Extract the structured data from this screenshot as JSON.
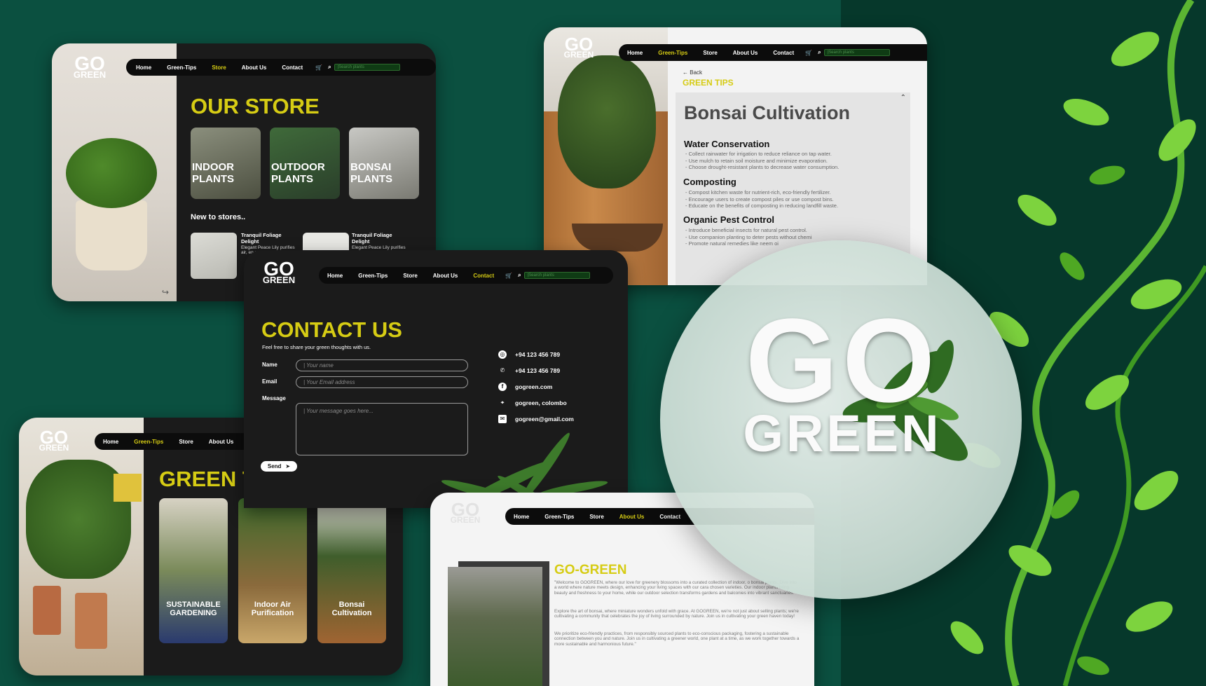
{
  "brand": {
    "logo_top": "GO",
    "logo_bottom": "GREEN"
  },
  "nav_items": [
    "Home",
    "Green-Tips",
    "Store",
    "About Us",
    "Contact"
  ],
  "search_placeholder": "|Search plants",
  "store": {
    "title": "OUR STORE",
    "categories": [
      "INDOOR\nPLANTS",
      "OUTDOOR\nPLANTS",
      "BONSAI\nPLANTS"
    ],
    "new_heading": "New to stores..",
    "products": [
      {
        "name": "Tranquil Foliage Delight",
        "desc": "Elegant Peace Lily purifies air, en spa gr"
      },
      {
        "name": "Tranquil Foliage Delight",
        "desc": "Elegant Peace Lily purifies"
      }
    ]
  },
  "tips_detail": {
    "back": "Back",
    "section": "GREEN TIPS",
    "title": "Bonsai Cultivation",
    "sections": [
      {
        "heading": "Water Conservation",
        "bullets": [
          "- Collect rainwater for irrigation to reduce reliance on tap water.",
          "- Use mulch to retain soil moisture and minimize evaporation.",
          "- Choose drought-resistant plants to decrease water consumption."
        ]
      },
      {
        "heading": "Composting",
        "bullets": [
          "- Compost kitchen waste for nutrient-rich, eco-friendly fertilizer.",
          "- Encourage users to create compost piles or use compost bins.",
          "- Educate on the benefits of composting in reducing landfill waste."
        ]
      },
      {
        "heading": "Organic Pest Control",
        "bullets": [
          "- Introduce beneficial insects for natural pest control.",
          "- Use companion planting to deter pests without chemi",
          "- Promote natural remedies like neem oi"
        ]
      }
    ]
  },
  "contact": {
    "title": "CONTACT US",
    "subtitle": "Feel free to share your green thoughts with us.",
    "name_label": "Name",
    "name_placeholder": "| Your name",
    "email_label": "Email",
    "email_placeholder": "| Your Email address",
    "message_label": "Message",
    "message_placeholder": "| Your message goes here...",
    "send_label": "Send",
    "info": [
      {
        "icon": "whatsapp-icon",
        "text": "+94 123 456 789"
      },
      {
        "icon": "phone-icon",
        "text": "+94 123 456 789"
      },
      {
        "icon": "facebook-icon",
        "text": "gogreen.com"
      },
      {
        "icon": "location-icon",
        "text": "gogreen, colombo"
      },
      {
        "icon": "mail-icon",
        "text": "gogreen@gmail.com"
      }
    ]
  },
  "tips_list": {
    "title": "GREEN T",
    "cards": [
      "SUSTAINABLE\nGARDENING",
      "Indoor Air\nPurification",
      "Bonsai\nCultivation"
    ]
  },
  "about": {
    "title": "GO-GREEN",
    "paragraphs": [
      "\"Welcome to GOGREEN, where our love for greenery blossoms into a curated collection of indoor, o bonsai plants. Dive into a world where nature meets design, enhancing your living spaces with our cara chosen varieties. Our indoor plants bring beauty and freshness to your home, while our outdoor selection transforms gardens and balconies into vibrant sanctuaries.",
      "Explore the art of bonsai, where miniature wonders unfold with grace. At GOGREEN, we're not just about selling plants; we're cultivating a community that celebrates the joy of living surrounded by nature. Join us in cultivating your green haven today!",
      "We prioritize eco-friendly practices, from responsibly sourced plants to eco-conscious packaging, fostering a sustainable connection between you and nature. Join us in cultivating a greener world, one plant at a time, as we work together towards a more sustainable and harmonious future.\""
    ]
  },
  "colors": {
    "accent": "#d6cc14",
    "dark": "#1b1b1b",
    "bg": "#0b5040",
    "bg_dark": "#06382b"
  }
}
